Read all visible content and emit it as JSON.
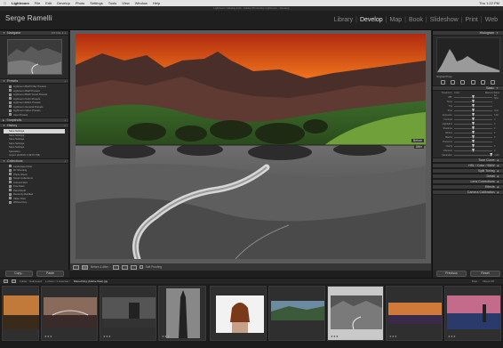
{
  "menubar": {
    "apple": "",
    "app_name": "Lightroom",
    "items": [
      "File",
      "Edit",
      "Develop",
      "Photo",
      "Settings",
      "Tools",
      "View",
      "Window",
      "Help"
    ]
  },
  "window_title": "Lightroom Catalog.lrcat - Adobe Photoshop Lightroom - Develop",
  "identity_plate": "Serge Ramelli",
  "modules": [
    {
      "label": "Library",
      "active": false
    },
    {
      "label": "Develop",
      "active": true
    },
    {
      "label": "Map",
      "active": false
    },
    {
      "label": "Book",
      "active": false
    },
    {
      "label": "Slideshow",
      "active": false
    },
    {
      "label": "Print",
      "active": false
    },
    {
      "label": "Web",
      "active": false
    }
  ],
  "left_panel": {
    "navigator_label": "Navigator",
    "navigator_zoom": "FIT  FILL  1:1",
    "presets_label": "Presets",
    "presets": [
      "Lightroom B&W Filter Presets",
      "Lightroom B&W Presets",
      "Lightroom B&W Toned Presets",
      "Lightroom Color Presets",
      "Lightroom Effect Presets",
      "Lightroom General Presets",
      "Lightroom Video Presets",
      "User Presets"
    ],
    "snapshots_label": "Snapshots",
    "history_label": "History",
    "history": [
      "Save Settings",
      "Save Settings",
      "Save Settings",
      "Save Settings",
      "Save Settings",
      "Saturation",
      "Import (4/23/15 1:09:07 PM)"
    ],
    "collections_label": "Collections",
    "collections": [
      "Landscape Pano",
      "Dc Shooting",
      "Photo Shoot",
      "Smart Collections",
      "Colored Red",
      "Five Stars",
      "Past Month",
      "Recently Modified",
      "Video Files",
      "Without Key..."
    ],
    "copy_button": "Copy...",
    "paste_button": "Paste"
  },
  "right_panel": {
    "histogram_label": "Histogram",
    "original_photo": "Original Photo",
    "basic_label": "Basic",
    "treatment_label": "Treatment:",
    "color_label": "Color",
    "bw_label": "Black & White",
    "sliders": [
      {
        "label": "WB:",
        "value": "As Shot",
        "pos": 0.5
      },
      {
        "label": "Temp",
        "value": "",
        "pos": 0.5
      },
      {
        "label": "Tint",
        "value": "",
        "pos": 0.5
      },
      {
        "label": "Tone",
        "value": "Auto",
        "pos": 0.5
      },
      {
        "label": "Exposure",
        "value": "0.00",
        "pos": 0.5
      },
      {
        "label": "Contrast",
        "value": "0",
        "pos": 0.5
      },
      {
        "label": "Highlights",
        "value": "0",
        "pos": 0.5
      },
      {
        "label": "Shadows",
        "value": "0",
        "pos": 0.5
      },
      {
        "label": "Whites",
        "value": "0",
        "pos": 0.5
      },
      {
        "label": "Blacks",
        "value": "0",
        "pos": 0.5
      },
      {
        "label": "Presence",
        "value": "",
        "pos": 0.5
      },
      {
        "label": "Clarity",
        "value": "0",
        "pos": 0.5
      },
      {
        "label": "Vibrance",
        "value": "0",
        "pos": 0.5
      },
      {
        "label": "Saturation",
        "value": "+100",
        "pos": 0.97
      }
    ],
    "sections": [
      "Tone Curve",
      "HSL / Color / B&W",
      "Split Toning",
      "Detail",
      "Lens Corrections",
      "Effects",
      "Camera Calibration"
    ],
    "previous_button": "Previous",
    "reset_button": "Reset"
  },
  "center": {
    "before_label": "Before",
    "after_label": "After"
  },
  "toolbar": {
    "before_after_label": "Before & After :",
    "soft_proofing_label": "Soft Proofing"
  },
  "filmstrip": {
    "header_source": "Folder : Hollywood",
    "header_info": "1 photo / 1 selected /",
    "header_filename": "Retouching (Adobe Raw).jpg",
    "filter_label": "Filter :",
    "filter_value": "Filters Off",
    "stars": "★★★"
  },
  "clock": "Thu 1:22 PM"
}
